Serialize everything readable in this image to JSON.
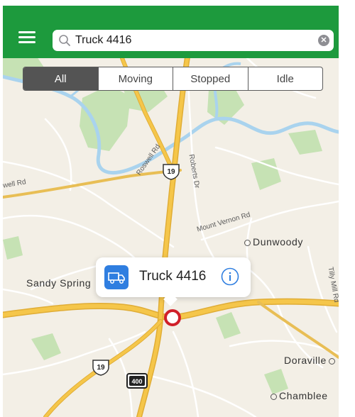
{
  "search": {
    "value": "Truck 4416"
  },
  "filters": [
    {
      "label": "All",
      "active": true
    },
    {
      "label": "Moving",
      "active": false
    },
    {
      "label": "Stopped",
      "active": false
    },
    {
      "label": "Idle",
      "active": false
    }
  ],
  "map": {
    "places": {
      "dunwoody": "Dunwoody",
      "sandy_springs": "Sandy Spring",
      "doraville": "Doraville",
      "chamblee": "Chamblee"
    },
    "roads": {
      "roswell_rd": "Roswell Rd",
      "roberts_dr": "Roberts Dr",
      "mount_vernon_rd": "Mount Vernon Rd",
      "tilly_mill_rd": "Tilly Mill Rd",
      "well_rd": "well Rd"
    },
    "shields": {
      "us19_north": "19",
      "us19_south": "19",
      "i400": "400"
    }
  },
  "callout": {
    "title": "Truck 4416"
  },
  "colors": {
    "brand_green": "#1d9a3d",
    "segment_active": "#545454",
    "truck_icon_blue": "#2f7ee0",
    "marker_red": "#d0202a",
    "highway_yellow": "#f5c64a"
  },
  "icons": {
    "menu": "hamburger-menu-icon",
    "search": "magnifier-icon",
    "clear": "clear-circle-icon",
    "truck": "truck-icon",
    "info": "info-circle-icon",
    "marker": "vehicle-location-marker"
  }
}
